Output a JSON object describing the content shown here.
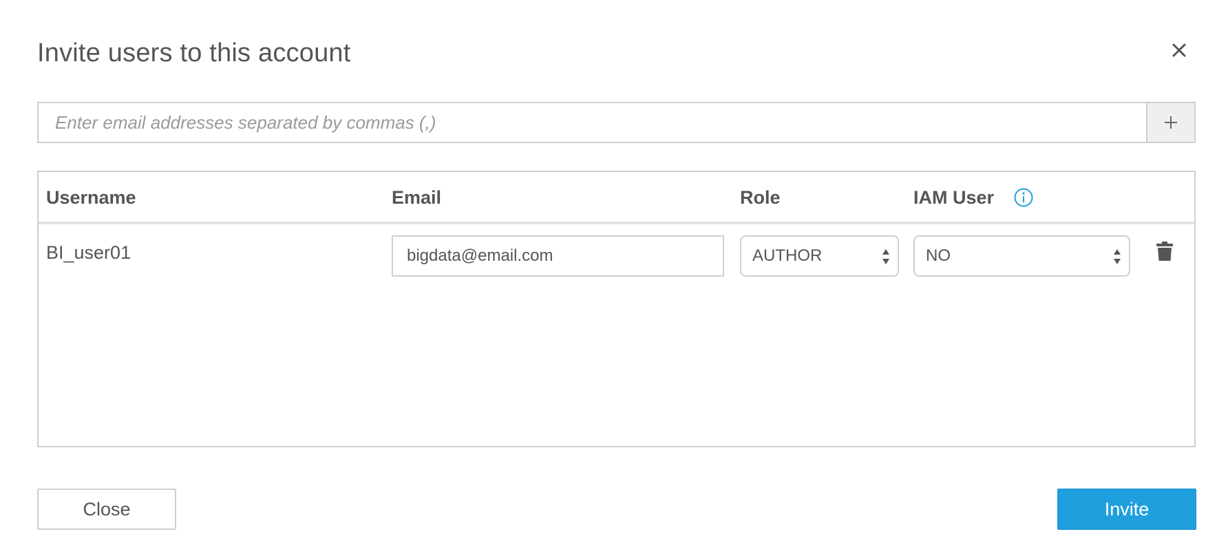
{
  "dialog": {
    "title": "Invite users to this account"
  },
  "email_entry": {
    "placeholder": "Enter email addresses separated by commas (,)",
    "add_icon": "plus-icon"
  },
  "table": {
    "columns": [
      "Username",
      "Email",
      "Role",
      "IAM User"
    ],
    "info_icon": "info-circle-icon",
    "rows": [
      {
        "username": "BI_user01",
        "email": "bigdata@email.com",
        "role": "AUTHOR",
        "iam_user": "NO",
        "delete_icon": "trash-icon"
      }
    ]
  },
  "footer": {
    "close_label": "Close",
    "invite_label": "Invite"
  },
  "colors": {
    "accent": "#1f9fde",
    "text": "#555555",
    "border": "#cfcfcf"
  }
}
